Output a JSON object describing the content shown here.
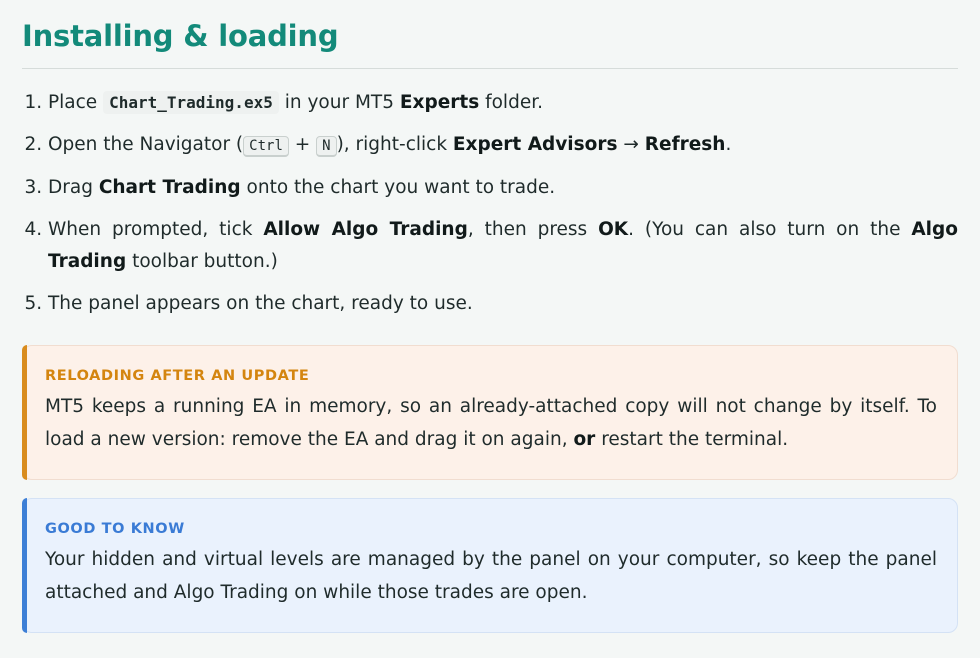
{
  "title": "Installing & loading",
  "steps": {
    "s1": {
      "a": "Place ",
      "code": "Chart_Trading.ex5",
      "b": " in your MT5 ",
      "bold": "Experts",
      "c": " folder."
    },
    "s2": {
      "a": "Open the Navigator (",
      "key1": "Ctrl",
      "plus": " + ",
      "key2": "N",
      "b": "), right-click ",
      "bold1": "Expert Advisors",
      "arrow": " → ",
      "bold2": "Refresh",
      "c": "."
    },
    "s3": {
      "a": "Drag ",
      "bold": "Chart Trading",
      "b": " onto the chart you want to trade."
    },
    "s4": {
      "a": "When prompted, tick ",
      "bold1": "Allow Algo Trading",
      "b": ", then press ",
      "bold2": "OK",
      "c": ". (You can also turn on the ",
      "bold3": "Algo Trading",
      "d": " toolbar button.)"
    },
    "s5": {
      "a": "The panel appears on the chart, ready to use."
    }
  },
  "callouts": {
    "reload": {
      "heading": "RELOADING AFTER AN UPDATE",
      "a": "MT5 keeps a running EA in memory, so an already-attached copy will not change by itself. To load a new version: remove the EA and drag it on again, ",
      "bold": "or",
      "b": " restart the terminal.",
      "accent": "#d98c1e"
    },
    "good": {
      "heading": "GOOD TO KNOW",
      "text": "Your hidden and virtual levels are managed by the panel on your computer, so keep the panel attached and Algo Trading on while those trades are open.",
      "accent": "#3d7fd6"
    }
  }
}
